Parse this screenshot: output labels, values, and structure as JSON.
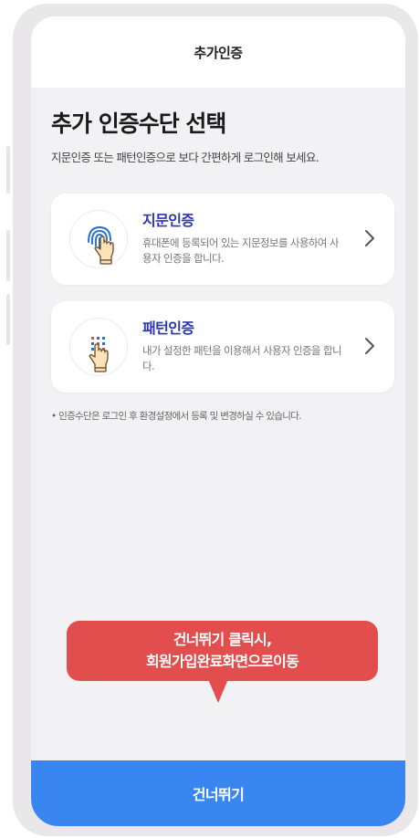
{
  "header": {
    "title": "추가인증"
  },
  "main": {
    "title": "추가 인증수단 선택",
    "subtitle": "지문인증 또는 패턴인증으로 보다 간편하게 로그인해 보세요."
  },
  "cards": [
    {
      "title": "지문인증",
      "desc": "휴대폰에 등록되어 있는 지문정보를 사용하여 사용자 인증을 합니다.",
      "icon": "fingerprint-touch-icon"
    },
    {
      "title": "패턴인증",
      "desc": "내가 설정한 패턴을 이용해서 사용자 인증을 합니다.",
      "icon": "pattern-touch-icon"
    }
  ],
  "note": "• 인증수단은 로그인 후 환경설정에서 등록 및 변경하실 수 있습니다.",
  "tooltip": {
    "line1": "건너뛰기 클릭시,",
    "line2": "회원가입완료화면으로이동"
  },
  "footer": {
    "skip_label": "건너뛰기"
  },
  "colors": {
    "accent_blue": "#3a86f0",
    "card_title": "#2b36b8",
    "tooltip_red": "#e24d4d",
    "background": "#f2f2f4"
  }
}
